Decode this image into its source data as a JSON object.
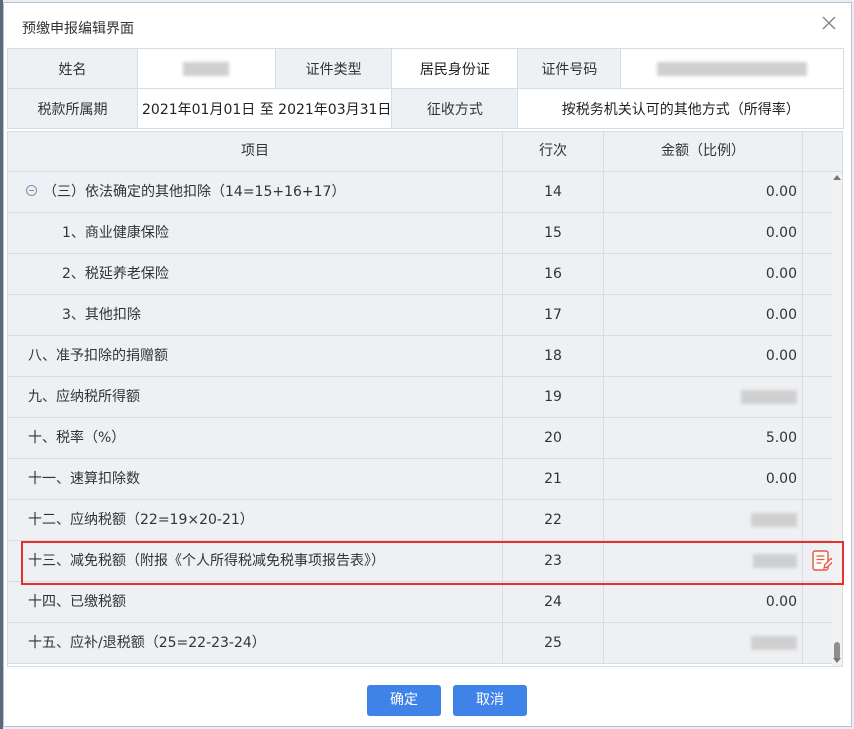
{
  "dialog": {
    "title": "预缴申报编辑界面",
    "close_icon": "close-icon",
    "info": {
      "name_label": "姓名",
      "id_type_label": "证件类型",
      "id_type_value": "居民身份证",
      "id_number_label": "证件号码",
      "period_label": "税款所属期",
      "period_value": "2021年01月01日 至 2021年03月31日",
      "method_label": "征收方式",
      "method_value": "按税务机关认可的其他方式（所得率）"
    },
    "grid": {
      "headers": [
        "项目",
        "行次",
        "金额（比例）",
        ""
      ],
      "rows": [
        {
          "item": "（三）依法确定的其他扣除（14=15+16+17）",
          "line": "14",
          "amount": "0.00",
          "collapsible": true
        },
        {
          "item": "1、商业健康保险",
          "line": "15",
          "amount": "0.00"
        },
        {
          "item": "2、税延养老保险",
          "line": "16",
          "amount": "0.00"
        },
        {
          "item": "3、其他扣除",
          "line": "17",
          "amount": "0.00"
        },
        {
          "item": "八、准予扣除的捐赠额",
          "line": "18",
          "amount": "0.00"
        },
        {
          "item": "九、应纳税所得额",
          "line": "19",
          "amount": ""
        },
        {
          "item": "十、税率（%）",
          "line": "20",
          "amount": "5.00"
        },
        {
          "item": "十一、速算扣除数",
          "line": "21",
          "amount": "0.00"
        },
        {
          "item": "十二、应纳税额（22=19×20-21）",
          "line": "22",
          "amount": ""
        },
        {
          "item": "十三、减免税额（附报《个人所得税减免税事项报告表》）",
          "line": "23",
          "amount": "",
          "action_icon": "edit-form-icon"
        },
        {
          "item": "十四、已缴税额",
          "line": "24",
          "amount": "0.00"
        },
        {
          "item": "十五、应补/退税额（25=22-23-24）",
          "line": "25",
          "amount": ""
        }
      ]
    },
    "buttons": {
      "confirm": "确定",
      "cancel": "取消"
    },
    "colors": {
      "accent": "#3f82e8",
      "highlight": "#e8302a"
    }
  }
}
